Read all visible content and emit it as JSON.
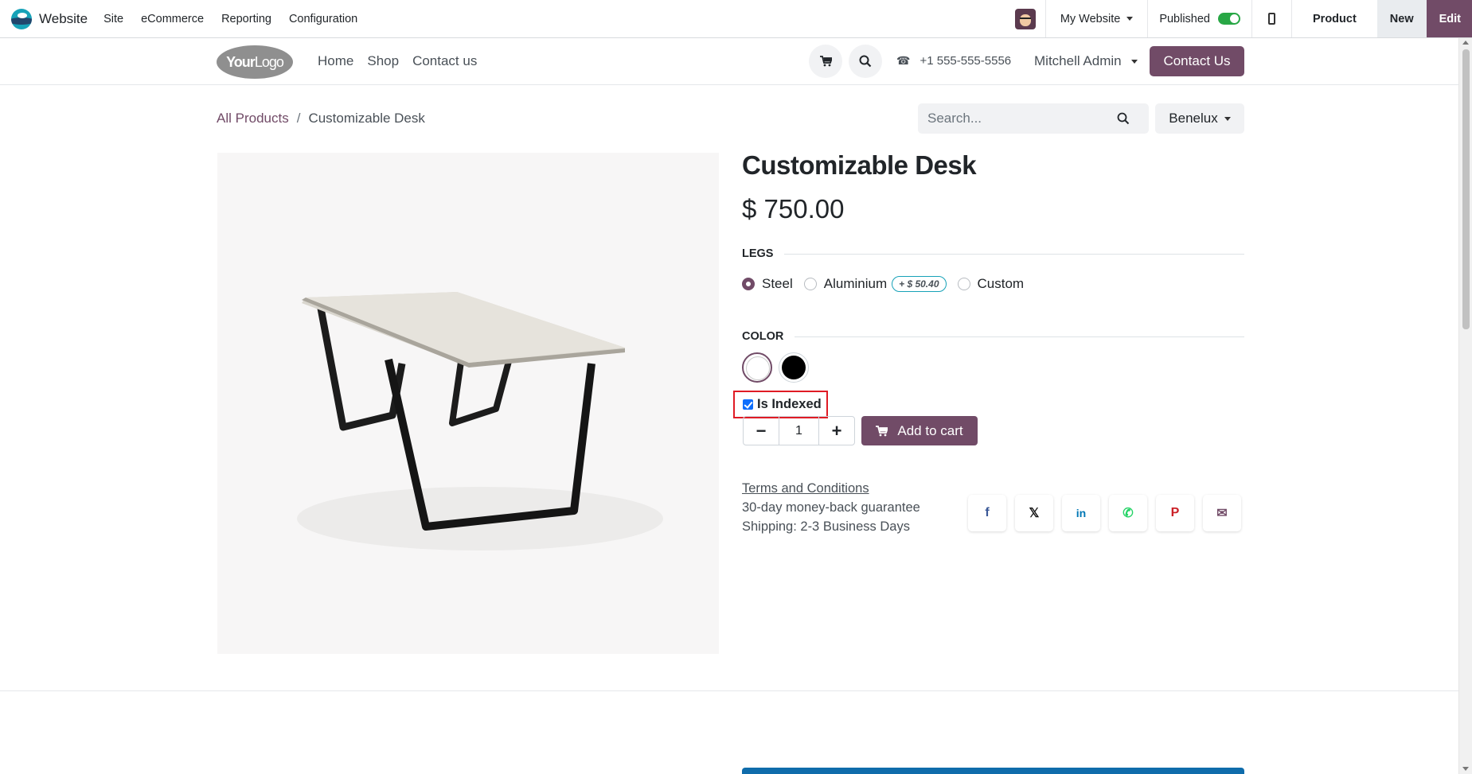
{
  "topbar": {
    "app_name": "Website",
    "menu": [
      "Site",
      "eCommerce",
      "Reporting",
      "Configuration"
    ],
    "website_selector": "My Website",
    "published_label": "Published",
    "published_on": true,
    "product_label": "Product",
    "new_label": "New",
    "edit_label": "Edit"
  },
  "header": {
    "logo_text_a": "Your",
    "logo_text_b": "Logo",
    "nav": [
      "Home",
      "Shop",
      "Contact us"
    ],
    "phone": "+1 555-555-5556",
    "user": "Mitchell Admin",
    "contact_button": "Contact Us"
  },
  "breadcrumb": {
    "root": "All Products",
    "separator": "/",
    "current": "Customizable Desk"
  },
  "search": {
    "placeholder": "Search..."
  },
  "pricelist": "Benelux",
  "product": {
    "name": "Customizable Desk",
    "price": "$ 750.00",
    "legs_label": "LEGS",
    "legs_options": [
      {
        "label": "Steel",
        "selected": true,
        "extra": ""
      },
      {
        "label": "Aluminium",
        "selected": false,
        "extra": "+ $ 50.40"
      },
      {
        "label": "Custom",
        "selected": false,
        "extra": ""
      }
    ],
    "color_label": "COLOR",
    "color_options": [
      {
        "name": "White",
        "hex": "#ffffff",
        "selected": true
      },
      {
        "name": "Black",
        "hex": "#000000",
        "selected": false
      }
    ],
    "is_indexed_label": "Is Indexed",
    "is_indexed_checked": true,
    "quantity": "1",
    "add_to_cart": "Add to cart",
    "terms_link": "Terms and Conditions",
    "guarantee": "30-day money-back guarantee",
    "shipping": "Shipping: 2-3 Business Days"
  },
  "share_icons": [
    "facebook-icon",
    "x-icon",
    "linkedin-icon",
    "whatsapp-icon",
    "pinterest-icon",
    "email-icon"
  ],
  "colors": {
    "brand": "#714b67",
    "accent_teal": "#17a2b8",
    "highlight_red": "#e01b24"
  }
}
